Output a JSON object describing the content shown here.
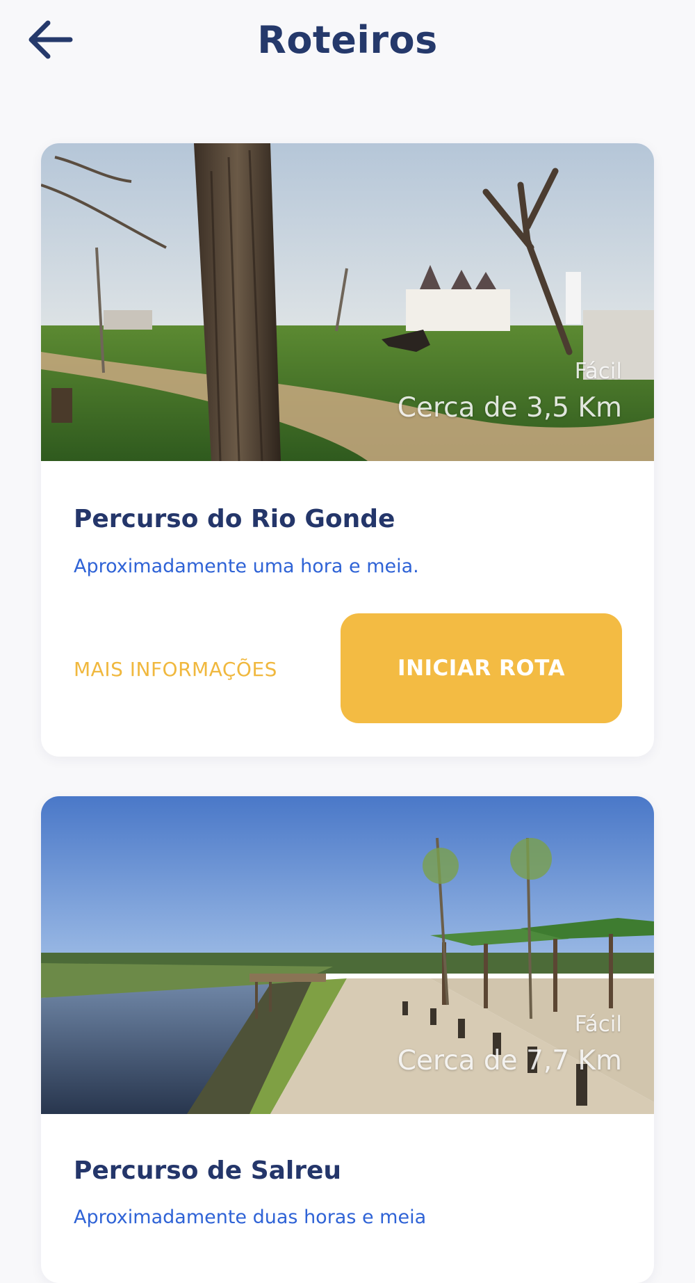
{
  "header": {
    "title": "Roteiros",
    "back_icon": "arrow-left-icon"
  },
  "colors": {
    "primary": "#25396b",
    "accent": "#f3bb43",
    "link": "#2f63d6",
    "background": "#f8f8fa"
  },
  "routes": [
    {
      "difficulty": "Fácil",
      "distance": "Cerca de 3,5 Km",
      "title": "Percurso do Rio Gonde",
      "duration": "Aproximadamente uma hora e meia.",
      "more_label": "MAIS INFORMAÇÕES",
      "start_label": "INICIAR ROTA"
    },
    {
      "difficulty": "Fácil",
      "distance": "Cerca de 7,7 Km",
      "title": "Percurso de Salreu",
      "duration": "Aproximadamente duas horas e meia"
    }
  ]
}
